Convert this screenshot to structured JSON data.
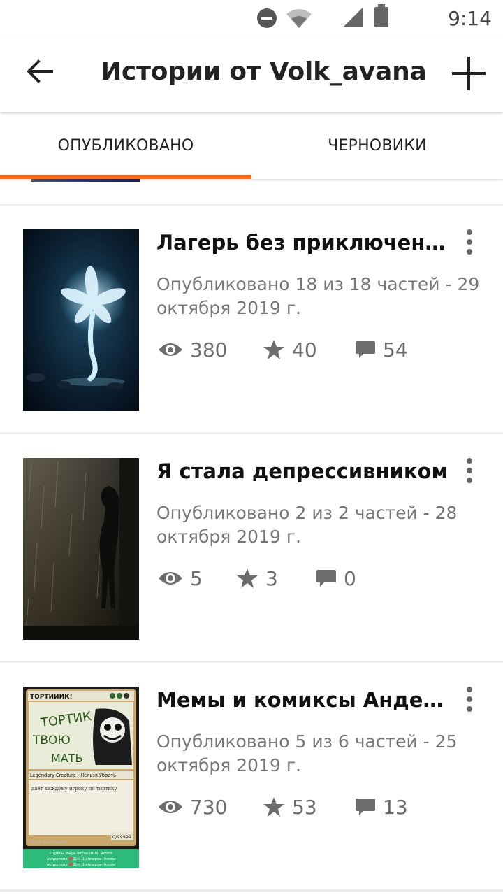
{
  "status_bar": {
    "time": "9:14"
  },
  "app_bar": {
    "title": "Истории от Volk_avana"
  },
  "tabs": [
    {
      "label": "ОПУБЛИКОВАНО",
      "active": true
    },
    {
      "label": "ЧЕРНОВИКИ",
      "active": false
    }
  ],
  "colors": {
    "accent": "#ff6a13",
    "meta_text": "#777777",
    "icon_gray": "#6d6d6d"
  },
  "stories": [
    {
      "title": "Лагерь без приключений …",
      "meta": "Опубликовано 18 из 18 частей - 29 октября 2019 г.",
      "views": "380",
      "votes": "40",
      "comments": "54"
    },
    {
      "title": "Я стала депрессивником",
      "meta": "Опубликовано 2 из 2 частей - 28 октября 2019 г.",
      "views": "5",
      "votes": "3",
      "comments": "0"
    },
    {
      "title": "Мемы и комиксы Андерт…",
      "meta": "Опубликовано 5 из 6 частей - 25 октября 2019 г.",
      "views": "730",
      "votes": "53",
      "comments": "13",
      "cover_text": {
        "card_name": "ТОРТИИИК!",
        "art_line1": "ТОРТИК",
        "art_line2": "ТВОЮ",
        "art_line3": "МАТЬ",
        "type_line": "Legendary Creature - Нельзя Убрать",
        "rules": "даёт каждому игроку по тортику",
        "pt": "0/99999",
        "credit": "Magic Card Designer",
        "footer1": "Страны Мира Amino (RUS) Amino",
        "footer2": "Андертейл 💔Для Шипперов- Amino",
        "footer3": "Андертейл 💔Для Шипперов- Amino"
      }
    }
  ]
}
